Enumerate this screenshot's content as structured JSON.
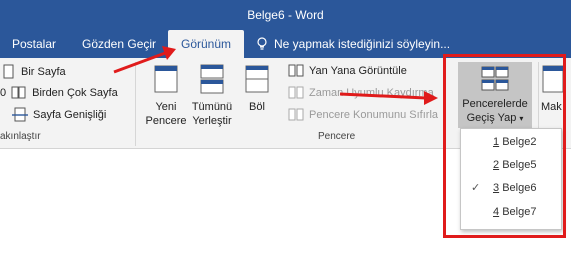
{
  "window": {
    "title": "Belge6 - Word"
  },
  "tabs": [
    {
      "label": "Postalar"
    },
    {
      "label": "Gözden Geçir"
    },
    {
      "label": "Görünüm",
      "active": true
    }
  ],
  "tell_me": {
    "text": "Ne yapmak istediğinizi söyleyin..."
  },
  "ribbon": {
    "zoom_group": {
      "label": "akınlaştır",
      "buttons": [
        {
          "label": "Bir Sayfa"
        },
        {
          "label": "Birden Çok Sayfa"
        },
        {
          "label": "Sayfa Genişliği"
        }
      ],
      "left_fragment": "0"
    },
    "window_group": {
      "label": "Pencere",
      "new_window": {
        "line1": "Yeni",
        "line2": "Pencere"
      },
      "arrange_all": {
        "line1": "Tümünü",
        "line2": "Yerleştir"
      },
      "split": {
        "label": "Böl"
      },
      "side_by_side": {
        "label": "Yan Yana Görüntüle"
      },
      "sync_scroll": {
        "label": "Zaman Uyumlu Kaydırma"
      },
      "reset_position": {
        "label": "Pencere Konumunu Sıfırla"
      },
      "switch_windows": {
        "line1": "Pencerelerde",
        "line2": "Geçiş Yap"
      }
    },
    "macros_fragment": "Mak"
  },
  "switch_menu": {
    "items": [
      {
        "num": "1",
        "label": "Belge2",
        "checked": false
      },
      {
        "num": "2",
        "label": "Belge5",
        "checked": false
      },
      {
        "num": "3",
        "label": "Belge6",
        "checked": true
      },
      {
        "num": "4",
        "label": "Belge7",
        "checked": false
      }
    ],
    "check_glyph": "✓"
  },
  "colors": {
    "accent": "#2b579a",
    "annotation": "#e01b1b"
  }
}
